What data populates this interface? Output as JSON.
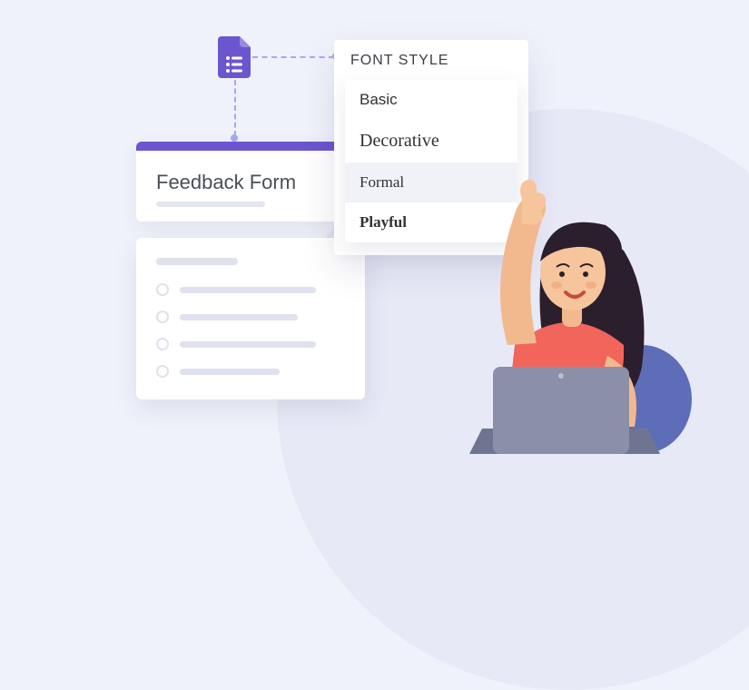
{
  "form": {
    "title": "Feedback Form"
  },
  "font_panel": {
    "heading": "FONT STYLE",
    "options": {
      "basic": "Basic",
      "decorative": "Decorative",
      "formal": "Formal",
      "playful": "Playful"
    },
    "selected": "formal"
  },
  "colors": {
    "accent": "#6b56cf",
    "background": "#f0f2fb"
  }
}
